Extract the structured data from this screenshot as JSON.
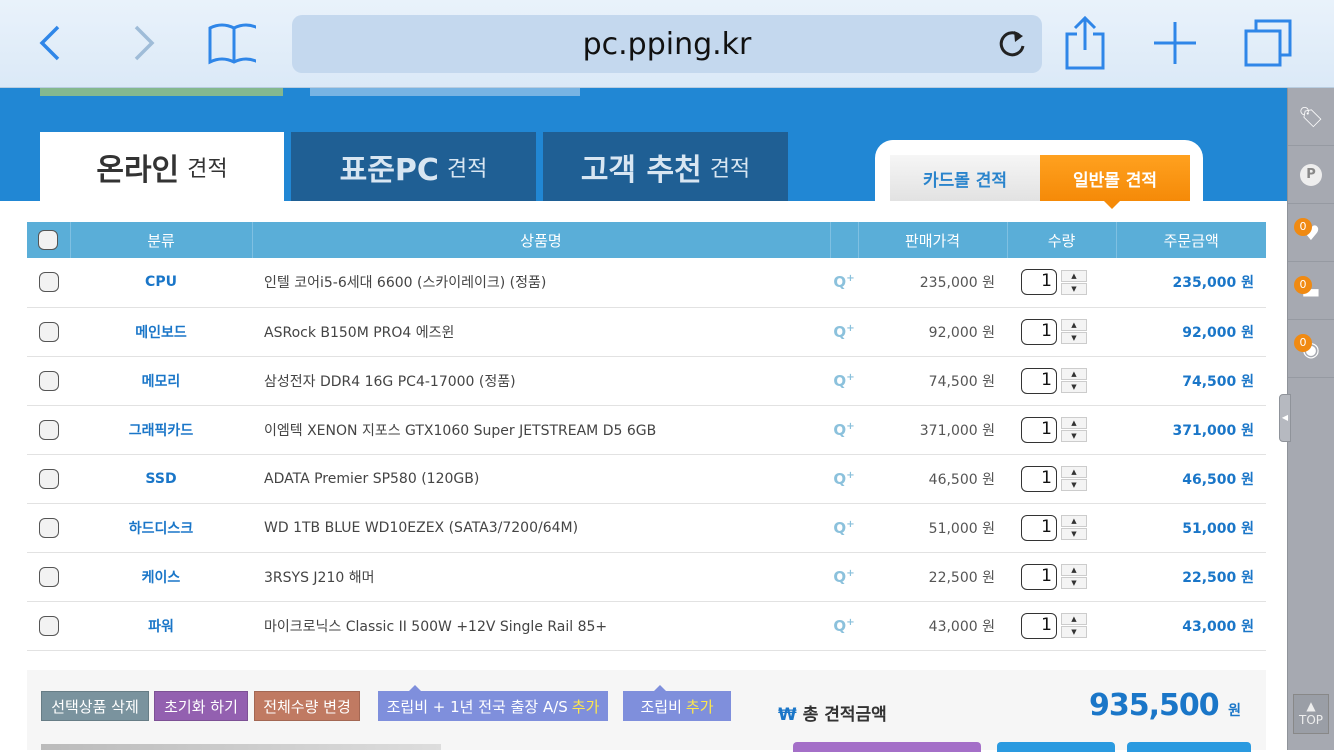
{
  "browser": {
    "url": "pc.pping.kr"
  },
  "tabs": [
    {
      "main": "온라인",
      "sub": "견적"
    },
    {
      "main": "표준PC",
      "sub": "견적"
    },
    {
      "main": "고객 추천",
      "sub": "견적"
    }
  ],
  "mall_tabs": [
    "카드몰 견적",
    "일반몰 견적"
  ],
  "table": {
    "headers": [
      "분류",
      "상품명",
      "판매가격",
      "수량",
      "주문금액"
    ],
    "rows": [
      {
        "cat": "CPU",
        "name": "인텔 코어i5-6세대 6600 (스카이레이크) (정품)",
        "price": "235,000 원",
        "qty": "1",
        "total": "235,000 원"
      },
      {
        "cat": "메인보드",
        "name": "ASRock B150M PRO4 에즈윈",
        "price": "92,000 원",
        "qty": "1",
        "total": "92,000 원"
      },
      {
        "cat": "메모리",
        "name": "삼성전자 DDR4 16G PC4-17000 (정품)",
        "price": "74,500 원",
        "qty": "1",
        "total": "74,500 원"
      },
      {
        "cat": "그래픽카드",
        "name": "이엠텍 XENON 지포스 GTX1060 Super JETSTREAM D5 6GB",
        "price": "371,000 원",
        "qty": "1",
        "total": "371,000 원"
      },
      {
        "cat": "SSD",
        "name": "ADATA Premier SP580 (120GB)",
        "price": "46,500 원",
        "qty": "1",
        "total": "46,500 원"
      },
      {
        "cat": "하드디스크",
        "name": "WD 1TB BLUE WD10EZEX (SATA3/7200/64M)",
        "price": "51,000 원",
        "qty": "1",
        "total": "51,000 원"
      },
      {
        "cat": "케이스",
        "name": "3RSYS J210 해머",
        "price": "22,500 원",
        "qty": "1",
        "total": "22,500 원"
      },
      {
        "cat": "파워",
        "name": "마이크로닉스 Classic II 500W +12V Single Rail 85+",
        "price": "43,000 원",
        "qty": "1",
        "total": "43,000 원"
      }
    ]
  },
  "footer": {
    "delete": "선택상품 삭제",
    "reset": "초기화 하기",
    "qty_change": "전체수량 변경",
    "assembly_as": "조립비 + 1년 전국 출장 A/S",
    "assembly": "조립비",
    "add": "추가",
    "total_label": "총 견적금액",
    "total_symbol": "₩",
    "total": "935,500",
    "won": "원"
  },
  "sidebar": {
    "badges": [
      "0",
      "0",
      "0"
    ],
    "top": "TOP"
  }
}
